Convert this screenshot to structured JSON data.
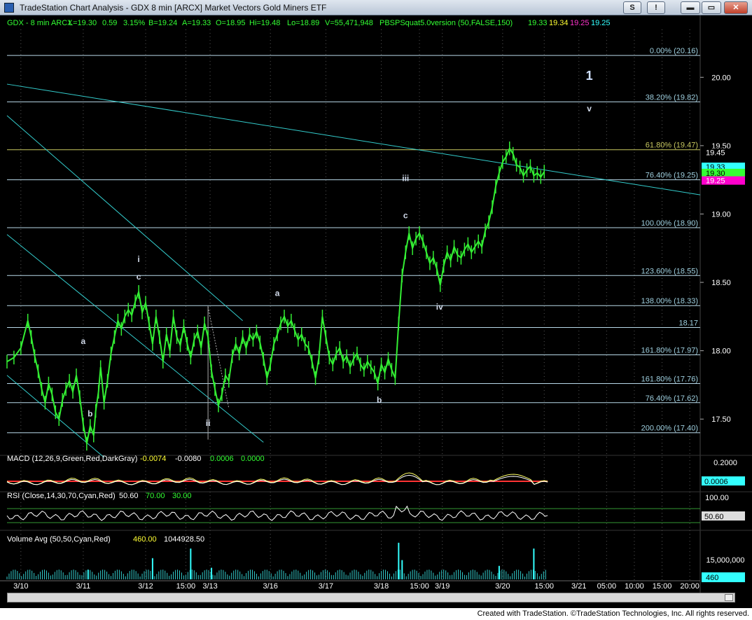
{
  "window": {
    "title": "TradeStation Chart Analysis - GDX 8 min [ARCX] Market Vectors Gold Miners ETF",
    "buttons": {
      "s": "S",
      "exclaim": "!",
      "minimize": "▬",
      "maximize": "▭",
      "close": "✕"
    }
  },
  "footer": "Created with TradeStation. ©TradeStation Technologies, Inc. All rights reserved.",
  "chart_data": {
    "type": "candlestick",
    "header": {
      "symbol": "GDX - 8 min  ARCX",
      "fields": [
        "L=19.30",
        "0.59",
        "3.15%",
        "B=19.24",
        "A=19.33",
        "O=18.95",
        "Hi=19.48",
        "Lo=18.89",
        "V=55,471,948"
      ],
      "indicator": "PBSPSquat5.0version (50,FALSE,150)",
      "ind_values": [
        {
          "text": "19.33",
          "color": "#33ff33"
        },
        {
          "text": "19.34",
          "color": "#ffff33"
        },
        {
          "text": "19.25",
          "color": "#ff33cc"
        },
        {
          "text": "19.25",
          "color": "#33ffff"
        }
      ]
    },
    "price_axis": {
      "ylim": [
        17.25,
        20.35
      ],
      "ticks": [
        "20.00",
        "19.50",
        "19.00",
        "18.50",
        "18.00",
        "17.50"
      ]
    },
    "price_tags": [
      {
        "text": "19.45",
        "value": 19.45,
        "bg": "#000000",
        "fg": "#ffffff"
      },
      {
        "text": "19.33",
        "value": 19.345,
        "bg": "#33ffff",
        "fg": "#000000"
      },
      {
        "text": "19.30",
        "value": 19.3,
        "bg": "#33ff33",
        "fg": "#000000"
      },
      {
        "text": "19.25",
        "value": 19.245,
        "bg": "#ff00cc",
        "fg": "#ffffff"
      }
    ],
    "fib_levels": [
      {
        "label": "0.00% (20.16)",
        "value": 20.16
      },
      {
        "label": "38.20% (19.82)",
        "value": 19.82
      },
      {
        "label": "61.80% (19.47)",
        "value": 19.47
      },
      {
        "label": "76.40% (19.25)",
        "value": 19.25
      },
      {
        "label": "100.00% (18.90)",
        "value": 18.9
      },
      {
        "label": "123.60% (18.55)",
        "value": 18.55
      },
      {
        "label": "138.00% (18.33)",
        "value": 18.33
      },
      {
        "label": "18.17",
        "value": 18.17
      },
      {
        "label": "161.80% (17.97)",
        "value": 17.97
      },
      {
        "label": "161.80% (17.76)",
        "value": 17.76
      },
      {
        "label": "76.40% (17.62)",
        "value": 17.62
      },
      {
        "label": "200.00% (17.40)",
        "value": 17.4
      }
    ],
    "wave_labels": [
      {
        "text": "1",
        "x": 0.84,
        "value": 19.98,
        "big": true
      },
      {
        "text": "v",
        "x": 0.84,
        "value": 19.75
      },
      {
        "text": "iii",
        "x": 0.575,
        "value": 19.24
      },
      {
        "text": "c",
        "x": 0.575,
        "value": 18.97
      },
      {
        "text": "i",
        "x": 0.19,
        "value": 18.65
      },
      {
        "text": "c",
        "x": 0.19,
        "value": 18.52
      },
      {
        "text": "a",
        "x": 0.39,
        "value": 18.4
      },
      {
        "text": "a",
        "x": 0.11,
        "value": 18.05
      },
      {
        "text": "b",
        "x": 0.12,
        "value": 17.52
      },
      {
        "text": "b",
        "x": 0.537,
        "value": 17.62
      },
      {
        "text": "iv",
        "x": 0.624,
        "value": 18.3
      },
      {
        "text": "ii",
        "x": 0.29,
        "value": 17.45
      }
    ],
    "price_path": [
      [
        0.0,
        17.92
      ],
      [
        0.01,
        17.95
      ],
      [
        0.02,
        18.02
      ],
      [
        0.03,
        18.22
      ],
      [
        0.035,
        18.1
      ],
      [
        0.04,
        17.96
      ],
      [
        0.045,
        17.85
      ],
      [
        0.05,
        17.72
      ],
      [
        0.055,
        17.62
      ],
      [
        0.06,
        17.76
      ],
      [
        0.065,
        17.68
      ],
      [
        0.07,
        17.55
      ],
      [
        0.075,
        17.5
      ],
      [
        0.08,
        17.64
      ],
      [
        0.085,
        17.72
      ],
      [
        0.09,
        17.78
      ],
      [
        0.095,
        17.7
      ],
      [
        0.1,
        17.82
      ],
      [
        0.105,
        17.66
      ],
      [
        0.11,
        17.46
      ],
      [
        0.115,
        17.32
      ],
      [
        0.12,
        17.45
      ],
      [
        0.125,
        17.38
      ],
      [
        0.128,
        17.56
      ],
      [
        0.132,
        17.7
      ],
      [
        0.135,
        17.88
      ],
      [
        0.14,
        17.62
      ],
      [
        0.145,
        17.78
      ],
      [
        0.15,
        17.98
      ],
      [
        0.155,
        18.1
      ],
      [
        0.16,
        18.22
      ],
      [
        0.165,
        18.16
      ],
      [
        0.17,
        18.25
      ],
      [
        0.175,
        18.3
      ],
      [
        0.18,
        18.26
      ],
      [
        0.185,
        18.36
      ],
      [
        0.19,
        18.43
      ],
      [
        0.195,
        18.28
      ],
      [
        0.2,
        18.35
      ],
      [
        0.205,
        18.2
      ],
      [
        0.21,
        18.05
      ],
      [
        0.215,
        18.25
      ],
      [
        0.22,
        18.1
      ],
      [
        0.225,
        17.92
      ],
      [
        0.23,
        18.12
      ],
      [
        0.235,
        18.0
      ],
      [
        0.24,
        18.25
      ],
      [
        0.245,
        18.1
      ],
      [
        0.25,
        18.04
      ],
      [
        0.255,
        18.18
      ],
      [
        0.26,
        18.05
      ],
      [
        0.265,
        17.95
      ],
      [
        0.27,
        18.08
      ],
      [
        0.275,
        18.14
      ],
      [
        0.28,
        18.02
      ],
      [
        0.285,
        18.2
      ],
      [
        0.29,
        18.1
      ],
      [
        0.295,
        17.85
      ],
      [
        0.3,
        17.72
      ],
      [
        0.305,
        17.6
      ],
      [
        0.31,
        17.68
      ],
      [
        0.315,
        17.82
      ],
      [
        0.32,
        17.78
      ],
      [
        0.325,
        17.96
      ],
      [
        0.33,
        18.05
      ],
      [
        0.335,
        17.98
      ],
      [
        0.34,
        18.1
      ],
      [
        0.345,
        18.02
      ],
      [
        0.35,
        18.12
      ],
      [
        0.355,
        18.08
      ],
      [
        0.36,
        18.14
      ],
      [
        0.365,
        18.06
      ],
      [
        0.37,
        17.94
      ],
      [
        0.375,
        17.8
      ],
      [
        0.38,
        17.9
      ],
      [
        0.385,
        18.05
      ],
      [
        0.39,
        18.12
      ],
      [
        0.395,
        18.2
      ],
      [
        0.4,
        18.25
      ],
      [
        0.405,
        18.18
      ],
      [
        0.41,
        18.22
      ],
      [
        0.415,
        18.15
      ],
      [
        0.42,
        18.08
      ],
      [
        0.425,
        18.12
      ],
      [
        0.43,
        18.05
      ],
      [
        0.435,
        18.02
      ],
      [
        0.44,
        17.92
      ],
      [
        0.445,
        17.8
      ],
      [
        0.45,
        17.95
      ],
      [
        0.455,
        18.25
      ],
      [
        0.46,
        18.1
      ],
      [
        0.465,
        17.95
      ],
      [
        0.47,
        17.9
      ],
      [
        0.475,
        17.98
      ],
      [
        0.48,
        18.02
      ],
      [
        0.485,
        17.92
      ],
      [
        0.49,
        17.96
      ],
      [
        0.495,
        17.88
      ],
      [
        0.5,
        17.94
      ],
      [
        0.505,
        17.98
      ],
      [
        0.51,
        17.9
      ],
      [
        0.515,
        17.86
      ],
      [
        0.52,
        17.92
      ],
      [
        0.525,
        17.88
      ],
      [
        0.53,
        17.84
      ],
      [
        0.535,
        17.76
      ],
      [
        0.54,
        17.9
      ],
      [
        0.545,
        17.84
      ],
      [
        0.55,
        17.94
      ],
      [
        0.555,
        17.86
      ],
      [
        0.56,
        17.8
      ],
      [
        0.565,
        18.2
      ],
      [
        0.57,
        18.55
      ],
      [
        0.575,
        18.72
      ],
      [
        0.58,
        18.86
      ],
      [
        0.585,
        18.75
      ],
      [
        0.59,
        18.82
      ],
      [
        0.595,
        18.86
      ],
      [
        0.6,
        18.8
      ],
      [
        0.605,
        18.72
      ],
      [
        0.61,
        18.64
      ],
      [
        0.615,
        18.68
      ],
      [
        0.62,
        18.6
      ],
      [
        0.625,
        18.48
      ],
      [
        0.63,
        18.62
      ],
      [
        0.635,
        18.72
      ],
      [
        0.64,
        18.66
      ],
      [
        0.645,
        18.76
      ],
      [
        0.65,
        18.7
      ],
      [
        0.655,
        18.68
      ],
      [
        0.66,
        18.74
      ],
      [
        0.665,
        18.78
      ],
      [
        0.67,
        18.72
      ],
      [
        0.675,
        18.76
      ],
      [
        0.68,
        18.8
      ],
      [
        0.685,
        18.76
      ],
      [
        0.69,
        18.88
      ],
      [
        0.695,
        18.94
      ],
      [
        0.7,
        19.05
      ],
      [
        0.705,
        19.2
      ],
      [
        0.71,
        19.3
      ],
      [
        0.715,
        19.38
      ],
      [
        0.72,
        19.42
      ],
      [
        0.725,
        19.48
      ],
      [
        0.73,
        19.44
      ],
      [
        0.735,
        19.36
      ],
      [
        0.74,
        19.34
      ],
      [
        0.745,
        19.28
      ],
      [
        0.75,
        19.32
      ],
      [
        0.755,
        19.35
      ],
      [
        0.76,
        19.28
      ],
      [
        0.765,
        19.3
      ],
      [
        0.77,
        19.27
      ],
      [
        0.775,
        19.31
      ]
    ],
    "macd": {
      "label": "MACD (12,26,9,Green,Red,DarkGray)",
      "values": [
        {
          "text": "-0.0074",
          "color": "#ffff33"
        },
        {
          "text": "-0.0080",
          "color": "#ffffff"
        },
        {
          "text": "0.0006",
          "color": "#33ff33"
        },
        {
          "text": "0.0000",
          "color": "#33ff33"
        }
      ],
      "axis_label": "0.2000",
      "tag": "0.0006"
    },
    "rsi": {
      "label": "RSI (Close,14,30,70,Cyan,Red)",
      "values": [
        {
          "text": "50.60",
          "color": "#ffffff"
        },
        {
          "text": "70.00",
          "color": "#33ff33"
        },
        {
          "text": "30.00",
          "color": "#33ff33"
        }
      ],
      "axis_label": "100.00",
      "tag": "50.60"
    },
    "volume": {
      "label": "Volume Avg (50,50,Cyan,Red)",
      "values": [
        {
          "text": "460.00",
          "color": "#ffff33"
        },
        {
          "text": "1044928.50",
          "color": "#ffffff"
        }
      ],
      "axis_label": "15,000,000",
      "tag": "460",
      "spikes": [
        [
          0.117,
          0.25
        ],
        [
          0.21,
          0.55
        ],
        [
          0.265,
          0.8
        ],
        [
          0.295,
          0.3
        ],
        [
          0.565,
          0.95
        ],
        [
          0.57,
          0.5
        ],
        [
          0.71,
          0.35
        ],
        [
          0.76,
          0.8
        ]
      ]
    },
    "time_axis": [
      {
        "label": "3/10",
        "x": 0.02
      },
      {
        "label": "3/11",
        "x": 0.11
      },
      {
        "label": "3/12",
        "x": 0.2
      },
      {
        "label": "15:00",
        "x": 0.258
      },
      {
        "label": "3/13",
        "x": 0.293
      },
      {
        "label": "3/16",
        "x": 0.38
      },
      {
        "label": "3/17",
        "x": 0.46
      },
      {
        "label": "3/18",
        "x": 0.54
      },
      {
        "label": "15:00",
        "x": 0.595
      },
      {
        "label": "3/19",
        "x": 0.628
      },
      {
        "label": "3/20",
        "x": 0.715
      },
      {
        "label": "15:00",
        "x": 0.775
      },
      {
        "label": "3/21",
        "x": 0.825
      },
      {
        "label": "05:00",
        "x": 0.865
      },
      {
        "label": "10:00",
        "x": 0.905
      },
      {
        "label": "15:00",
        "x": 0.945
      },
      {
        "label": "20:00",
        "x": 0.985
      }
    ],
    "colors": {
      "price": "#33ee33",
      "fib_line": "#b8d8e8",
      "fib_label": "#9fd0e0",
      "trendline": "#33cccc",
      "grid": "#555555",
      "axis_text": "#ffffff"
    }
  }
}
